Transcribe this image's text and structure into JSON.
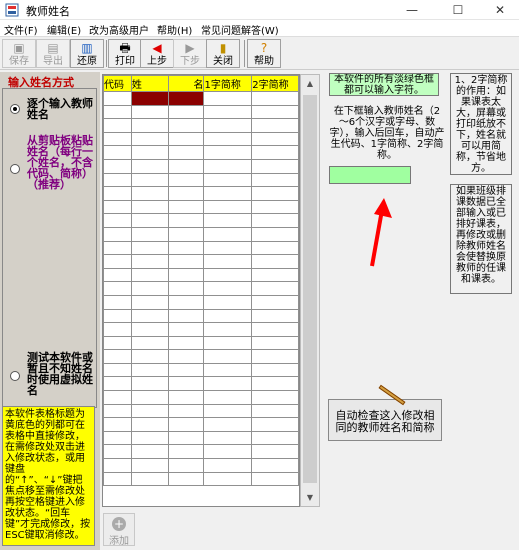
{
  "window": {
    "title": "教师姓名"
  },
  "menu": [
    "文件(F)",
    "编辑(E)",
    "改为高级用户",
    "帮助(H)",
    "常见问题解答(W)"
  ],
  "toolbar": {
    "save": "保存",
    "export": "导出",
    "restore": "还原",
    "print": "打印",
    "prev": "上步",
    "next": "下步",
    "close": "关闭",
    "help": "帮助"
  },
  "left_panel": {
    "title": "输入姓名方式",
    "option1": "逐个输入教师姓名",
    "option2": "从剪贴板粘贴姓名（每行一个姓名，不含代码、简称）（推荐）",
    "option3": "测试本软件或暂且不知姓名时使用虚拟姓名",
    "note": "本软件表格标题为黄底色的列都可在表格中直接修改，在需修改处双击进入修改状态，或用键盘的“↑”、“↓”键把焦点移至需修改处再按空格键进入修改状态。“回车键”才完成修改，按ESC键取消修改。"
  },
  "grid": {
    "headers": [
      "代码",
      "姓",
      "名",
      "1字简称",
      "2字简称"
    ]
  },
  "add_button": "添加",
  "right_panel": {
    "green_note": "本软件的所有淡绿色框都可以输入字符。",
    "instruction": "在下框输入教师姓名（2～6个汉字或字母、数字），输入后回车，自动产生代码、1字简称、2字简称。",
    "note1": "1、2字简称的作用：如果课表太大，屏幕或打印纸放不下，姓名就可以用简称，节省地方。",
    "note2": "如果班级排课数据已全部输入或已排好课表，再修改或删除教师姓名会使替换原教师的任课和课表。",
    "check_button": "自动检查这入修改相同的教师姓名和简称"
  },
  "colors": {
    "yellow": "#ffff00",
    "green": "#c0ffc0",
    "dark_red": "#8b0000",
    "title_red": "#c00000"
  }
}
